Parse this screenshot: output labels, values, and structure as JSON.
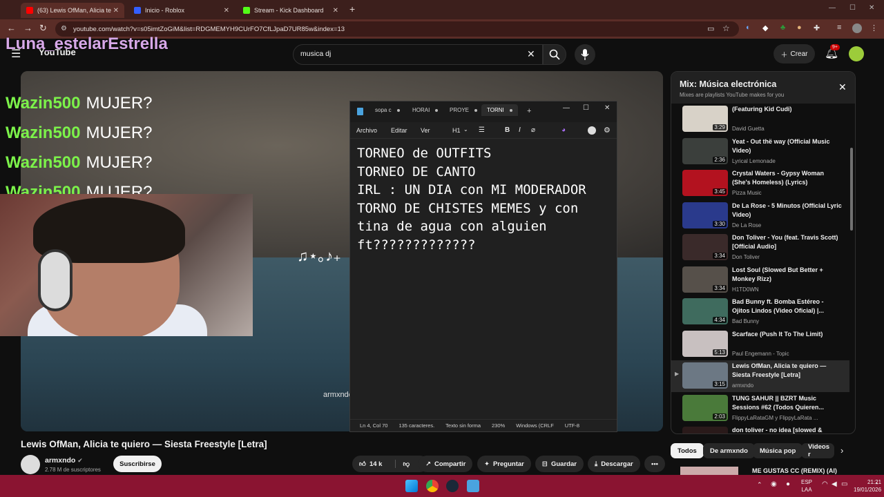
{
  "browser": {
    "tabs": [
      {
        "title": "(63) Lewis OfMan, Alicia te",
        "active": true
      },
      {
        "title": "Inicio - Roblox",
        "active": false
      },
      {
        "title": "Stream - Kick Dashboard",
        "active": false
      }
    ],
    "url": "youtube.com/watch?v=s05imtZoGiM&list=RDGMEMYH9CUrFO7CfLJpaD7UR85w&index=13"
  },
  "overlay": {
    "streamer_name": "Luna_estelarEstrella",
    "chat": [
      {
        "user": "Wazin500",
        "message": "MUJER?"
      },
      {
        "user": "Wazin500",
        "message": "MUJER?"
      },
      {
        "user": "Wazin500",
        "message": "MUJER?"
      },
      {
        "user": "Wazin500",
        "message": "MUJER?"
      }
    ]
  },
  "youtube": {
    "logo": "YouTube",
    "search_value": "musica dj",
    "create_label": "Crear",
    "notifications_badge": "9+"
  },
  "video": {
    "watermark": "armxndo",
    "notes": "♫⋆｡♪₊",
    "title": "Lewis OfMan, Alicia te quiero — Siesta Freestyle [Letra]",
    "channel": "armxndo",
    "subscribers": "2.78 M de suscriptores",
    "subscribe_label": "Suscribirse",
    "likes": "14 k",
    "share_label": "Compartir",
    "ask_label": "Preguntar",
    "save_label": "Guardar",
    "download_label": "Descargar"
  },
  "notepad": {
    "tabs": [
      "sopa c",
      "HORAI",
      "PROYE",
      "TORNI"
    ],
    "menu": {
      "file": "Archivo",
      "edit": "Editar",
      "view": "Ver",
      "heading": "H1"
    },
    "text": "TORNEO de OUTFITS\nTORNEO DE CANTO\nIRL : UN DIA con MI MODERADOR\nTORNO DE CHISTES MEMES y con\ntina de agua con alguien\nft?????????????",
    "status": {
      "position": "Ln 4, Col 70",
      "chars": "135 caracteres.",
      "format": "Texto sin forma",
      "zoom": "230%",
      "line_ending": "Windows (CRLF",
      "encoding": "UTF-8"
    }
  },
  "playlist": {
    "title": "Mix: Música electrónica",
    "subtitle": "Mixes are playlists YouTube makes for you",
    "items": [
      {
        "title": "(Featuring Kid Cudi)",
        "artist": "David Guetta",
        "duration": "3:29",
        "color": "#d8d2c8"
      },
      {
        "title": "Yeat - Out thë way (Official Music Video)",
        "artist": "Lyrical Lemonade",
        "duration": "2:36",
        "color": "#3b3f3c"
      },
      {
        "title": "Crystal Waters - Gypsy Woman (She's Homeless) (Lyrics)",
        "artist": "Pizza Music",
        "duration": "3:45",
        "color": "#b3121f"
      },
      {
        "title": "De La Rose - 5 Minutos (Official Lyric Video)",
        "artist": "De La Rose",
        "duration": "3:30",
        "color": "#2a3a8c"
      },
      {
        "title": "Don Toliver - You (feat. Travis Scott) [Official Audio]",
        "artist": "Don Toliver",
        "duration": "3:34",
        "color": "#3a2a2a"
      },
      {
        "title": "Lost Soul (Slowed But Better + Monkey Rizz)",
        "artist": "H1TD0WN",
        "duration": "3:34",
        "color": "#56504a"
      },
      {
        "title": "Bad Bunny ft. Bomba Estéreo - Ojitos Lindos (Video Oficial) |...",
        "artist": "Bad Bunny",
        "duration": "4:34",
        "color": "#3f6b5e"
      },
      {
        "title": "Scarface (Push It To The Limit)",
        "artist": "Paul Engemann - Topic",
        "duration": "5:13",
        "color": "#c8c0c0"
      },
      {
        "title": "Lewis OfMan, Alicia te quiero — Siesta Freestyle [Letra]",
        "artist": "armxndo",
        "duration": "3:15",
        "color": "#6c7884",
        "current": true
      },
      {
        "title": "TUNG SAHUR || BZRT Music Sessions #62 (Todos Quieren...",
        "artist": "FlippyLaRataGM y FlippyLaRata ...",
        "duration": "2:03",
        "color": "#4a7a3a"
      },
      {
        "title": "don toliver - no idea [slowed & reverb]",
        "artist": "",
        "duration": "",
        "color": "#2a1a1a"
      }
    ],
    "chips": [
      "Todos",
      "De armxndo",
      "Música pop",
      "Videos r"
    ],
    "next_item": "ME GUSTAS CC (REMIX) (AI)"
  },
  "taskbar": {
    "lang_top": "ESP",
    "lang_bottom": "LAA",
    "time": "21:21",
    "date": "19/01/2026"
  }
}
